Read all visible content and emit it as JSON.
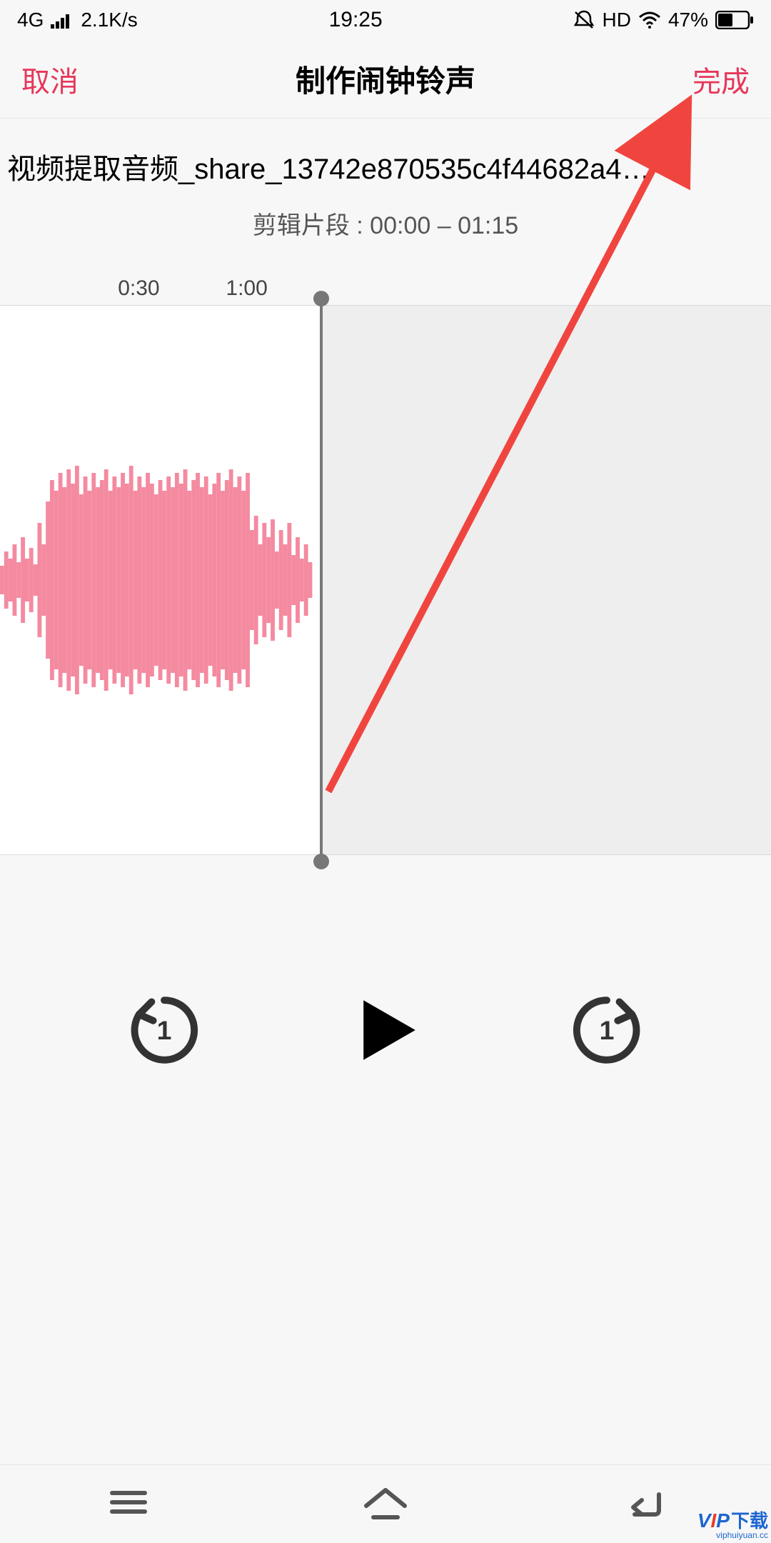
{
  "status": {
    "network": "4G",
    "speed": "2.1K/s",
    "time": "19:25",
    "hd": "HD",
    "battery_pct": "47%"
  },
  "nav": {
    "cancel": "取消",
    "title": "制作闹钟铃声",
    "done": "完成"
  },
  "file": {
    "name": "视频提取音频_share_13742e870535c4f44682a4…",
    "clip_label": "剪辑片段 : 00:00 – 01:15"
  },
  "timeline": {
    "ticks": [
      "0:30",
      "1:00"
    ],
    "tick_positions_pct": [
      18,
      32
    ],
    "trim_handle_pct": 41.5
  },
  "watermark": {
    "text": "VIP下载",
    "sub": "viphuiyuan.cc"
  }
}
